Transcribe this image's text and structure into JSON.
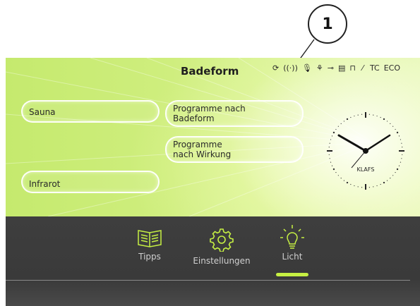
{
  "callout": {
    "number": "1"
  },
  "header": {
    "title": "Badeform",
    "status_icons": [
      "refresh-icon",
      "signal-icon",
      "microphone-icon",
      "plant-icon",
      "key-icon",
      "sauna-icon",
      "lock-icon",
      "wrench-icon"
    ],
    "status_text": {
      "tc": "TC",
      "eco": "ECO"
    }
  },
  "menu": {
    "sauna": "Sauna",
    "programme_badeform_line1": "Programme nach",
    "programme_badeform_line2": "Badeform",
    "programme_wirkung_line1": "Programme",
    "programme_wirkung_line2": "nach Wirkung",
    "infrarot": "Infrarot"
  },
  "clock": {
    "brand": "KLAFS"
  },
  "tabs": [
    {
      "label": "Tipps",
      "icon": "book-icon"
    },
    {
      "label": "Einstellungen",
      "icon": "gear-icon"
    },
    {
      "label": "Licht",
      "icon": "lightbulb-icon",
      "active": true
    }
  ],
  "colors": {
    "accent": "#c6f043",
    "bottom_bar": "#3e3e3e",
    "screen_green": "#cfee7e"
  }
}
